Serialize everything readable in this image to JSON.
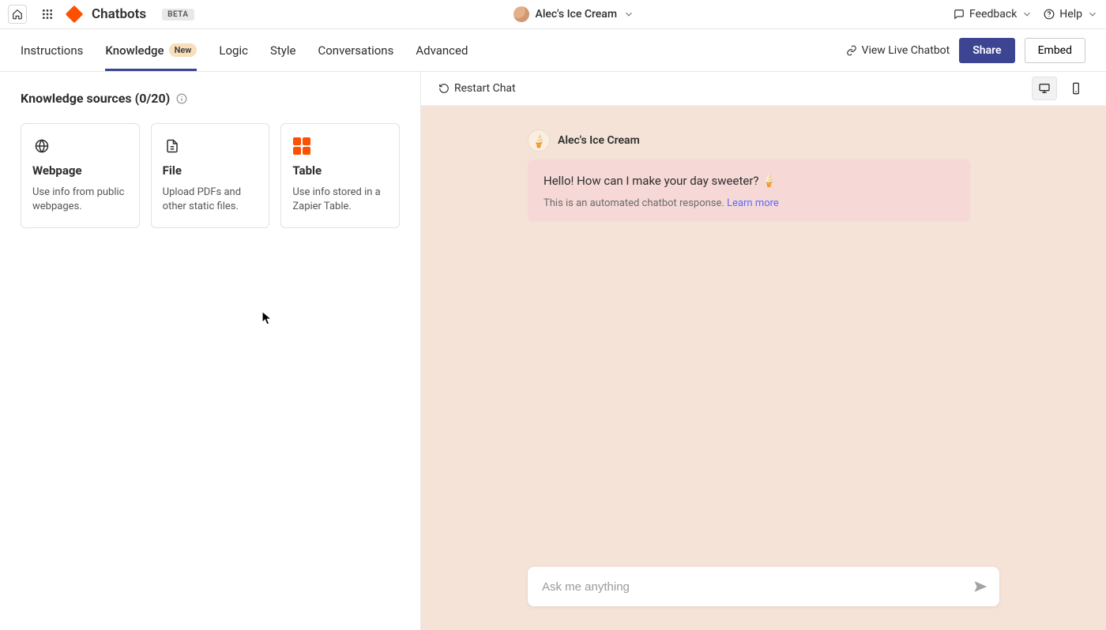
{
  "header": {
    "app_title": "Chatbots",
    "beta_label": "BETA",
    "chatbot_name": "Alec's Ice Cream",
    "feedback_label": "Feedback",
    "help_label": "Help"
  },
  "tabs": {
    "instructions": "Instructions",
    "knowledge": "Knowledge",
    "knowledge_badge": "New",
    "logic": "Logic",
    "style": "Style",
    "conversations": "Conversations",
    "advanced": "Advanced"
  },
  "sub_actions": {
    "view_live": "View Live Chatbot",
    "share": "Share",
    "embed": "Embed"
  },
  "knowledge": {
    "section_title": "Knowledge sources (0/20)",
    "sources": [
      {
        "title": "Webpage",
        "desc": "Use info from public webpages."
      },
      {
        "title": "File",
        "desc": "Upload PDFs and other static files."
      },
      {
        "title": "Table",
        "desc": "Use info stored in a Zapier Table."
      }
    ]
  },
  "chat": {
    "restart": "Restart Chat",
    "bot_name": "Alec's Ice Cream",
    "greeting": "Hello! How can I make your day sweeter? 🍦",
    "response_note_prefix": "This is an automated chatbot response. ",
    "learn_more": "Learn more",
    "input_placeholder": "Ask me anything"
  },
  "icons": {
    "home": "home-icon",
    "apps": "apps-icon",
    "dropdown": "chevron-down-icon",
    "feedback": "comment-icon",
    "help": "question-circle-icon",
    "link": "link-icon",
    "info": "info-circle-icon",
    "globe": "globe-icon",
    "file": "file-icon",
    "table": "table-icon",
    "restart": "restart-icon",
    "desktop": "desktop-icon",
    "mobile": "mobile-icon",
    "send": "send-icon"
  },
  "colors": {
    "zapier_orange": "#ff4f00",
    "accent_indigo": "#3d4592",
    "chat_bg": "#f4e3d6",
    "message_bg": "#f6d9d6",
    "link_blue": "#5b6aff"
  }
}
